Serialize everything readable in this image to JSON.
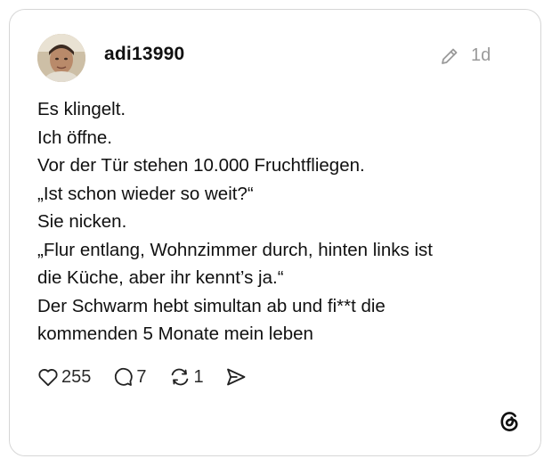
{
  "post": {
    "username": "adi13990",
    "timestamp": "1d",
    "text_lines": [
      "Es klingelt.",
      "Ich öffne.",
      "Vor der Tür stehen 10.000 Fruchtfliegen.",
      "„Ist schon wieder so weit?“",
      "Sie nicken.",
      "„Flur entlang, Wohnzimmer durch, hinten links ist",
      "die Küche, aber ihr kennt’s ja.“",
      "Der Schwarm hebt simultan ab und fi**t die",
      "kommenden 5 Monate mein leben"
    ]
  },
  "actions": {
    "likes": "255",
    "comments": "7",
    "reposts": "1"
  },
  "icons": {
    "edit": "pencil-icon",
    "like": "heart-icon",
    "comment": "comment-bubble-icon",
    "repost": "repost-icon",
    "share": "send-icon",
    "brand": "threads-logo-icon"
  },
  "colors": {
    "text": "#101010",
    "muted": "#9a9a9a",
    "border": "#d6d6d6"
  }
}
